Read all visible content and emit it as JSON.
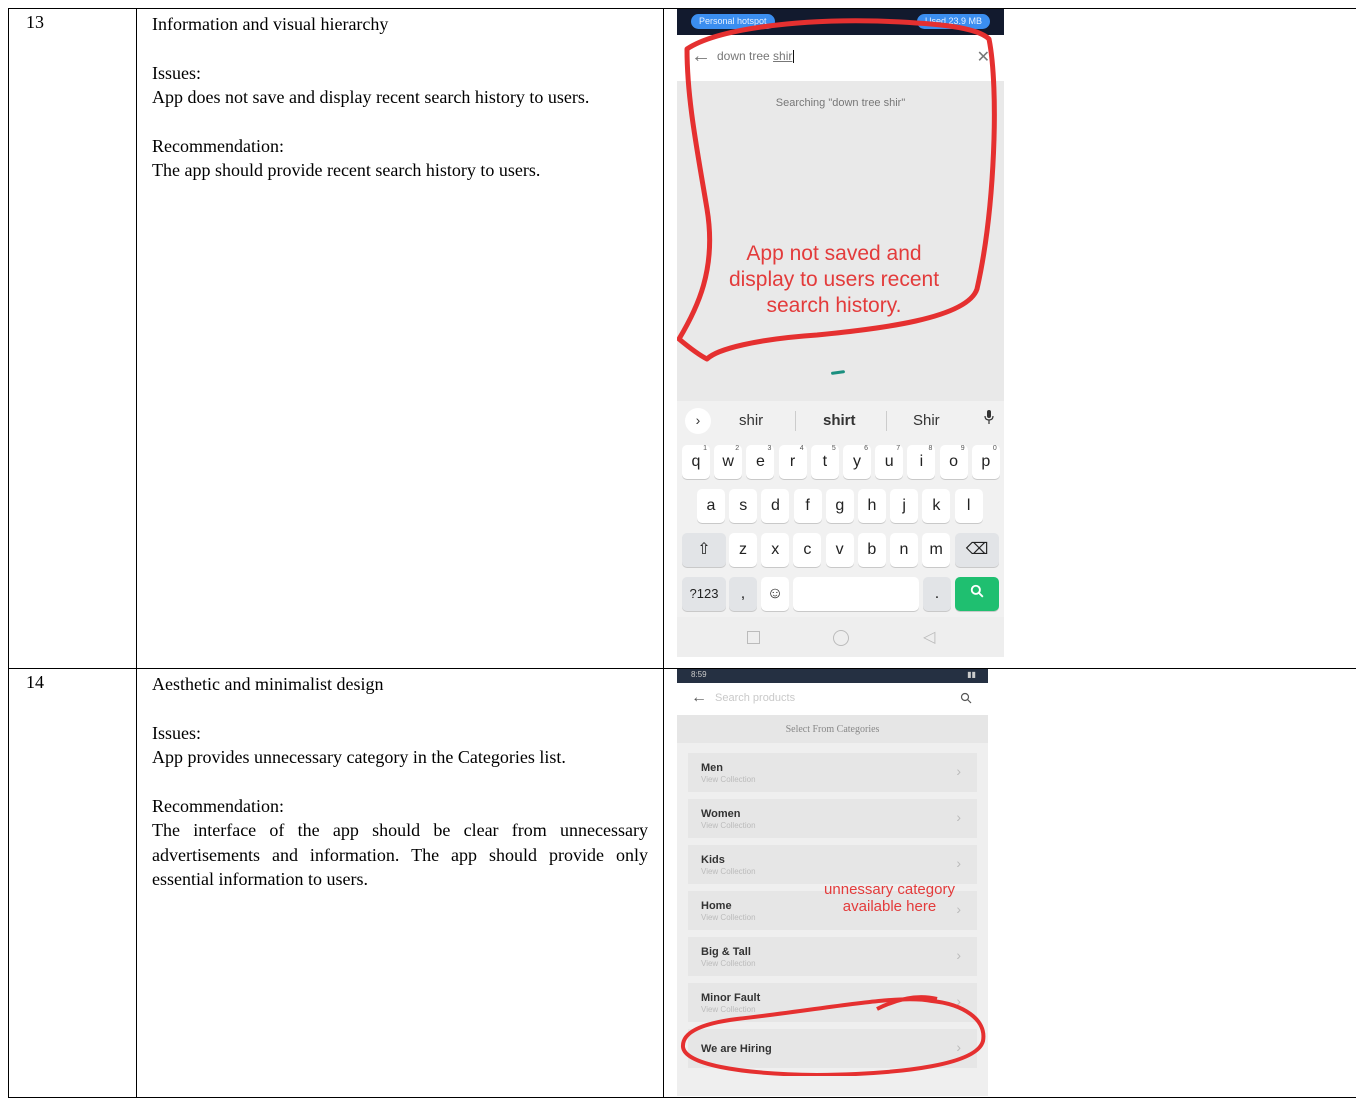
{
  "rows": [
    {
      "number": "13",
      "heading": "Information and visual hierarchy",
      "issues_label": "Issues:",
      "issues": "App does not save and display recent search history to users.",
      "recommendation_label": "Recommendation:",
      "recommendation": "The app should provide recent search history to users.",
      "screenshot": {
        "status_left": "Personal hotspot",
        "status_right": "Used 23.9 MB",
        "query_prefix": "down tree ",
        "query_underlined": "shir",
        "searching": "Searching \"down tree shir\"",
        "annotation_line1": "App not saved and",
        "annotation_line2": "display to users recent",
        "annotation_line3": "search history.",
        "suggestions": [
          "shir",
          "shirt",
          "Shir"
        ],
        "keys_row1": [
          "q",
          "w",
          "e",
          "r",
          "t",
          "y",
          "u",
          "i",
          "o",
          "p"
        ],
        "keys_row1_num": [
          "1",
          "2",
          "3",
          "4",
          "5",
          "6",
          "7",
          "8",
          "9",
          "0"
        ],
        "keys_row2": [
          "a",
          "s",
          "d",
          "f",
          "g",
          "h",
          "j",
          "k",
          "l"
        ],
        "keys_row3": [
          "z",
          "x",
          "c",
          "v",
          "b",
          "n",
          "m"
        ],
        "key_symbols": "?123",
        "key_comma": ",",
        "key_period": "."
      }
    },
    {
      "number": "14",
      "heading": "Aesthetic and minimalist design",
      "issues_label": "Issues:",
      "issues": "App provides unnecessary category in the Categories list.",
      "recommendation_label": "Recommendation:",
      "recommendation": "The interface of the app should be clear from unnecessary advertisements and information. The app should provide only essential information to users.",
      "screenshot": {
        "status_time": "8:59",
        "search_placeholder": "Search products",
        "section_title": "Select From Categories",
        "categories": [
          {
            "name": "Men",
            "sub": "View Collection"
          },
          {
            "name": "Women",
            "sub": "View Collection"
          },
          {
            "name": "Kids",
            "sub": "View Collection"
          },
          {
            "name": "Home",
            "sub": "View Collection"
          },
          {
            "name": "Big & Tall",
            "sub": "View Collection"
          },
          {
            "name": "Minor Fault",
            "sub": "View Collection"
          },
          {
            "name": "We are Hiring",
            "sub": ""
          }
        ],
        "annotation_line1": "unnessary category",
        "annotation_line2": "available here"
      }
    }
  ],
  "colors": {
    "annotation_red": "#e33b3b",
    "status_pill": "#3b8ef0",
    "enter_key": "#1fbf70"
  }
}
